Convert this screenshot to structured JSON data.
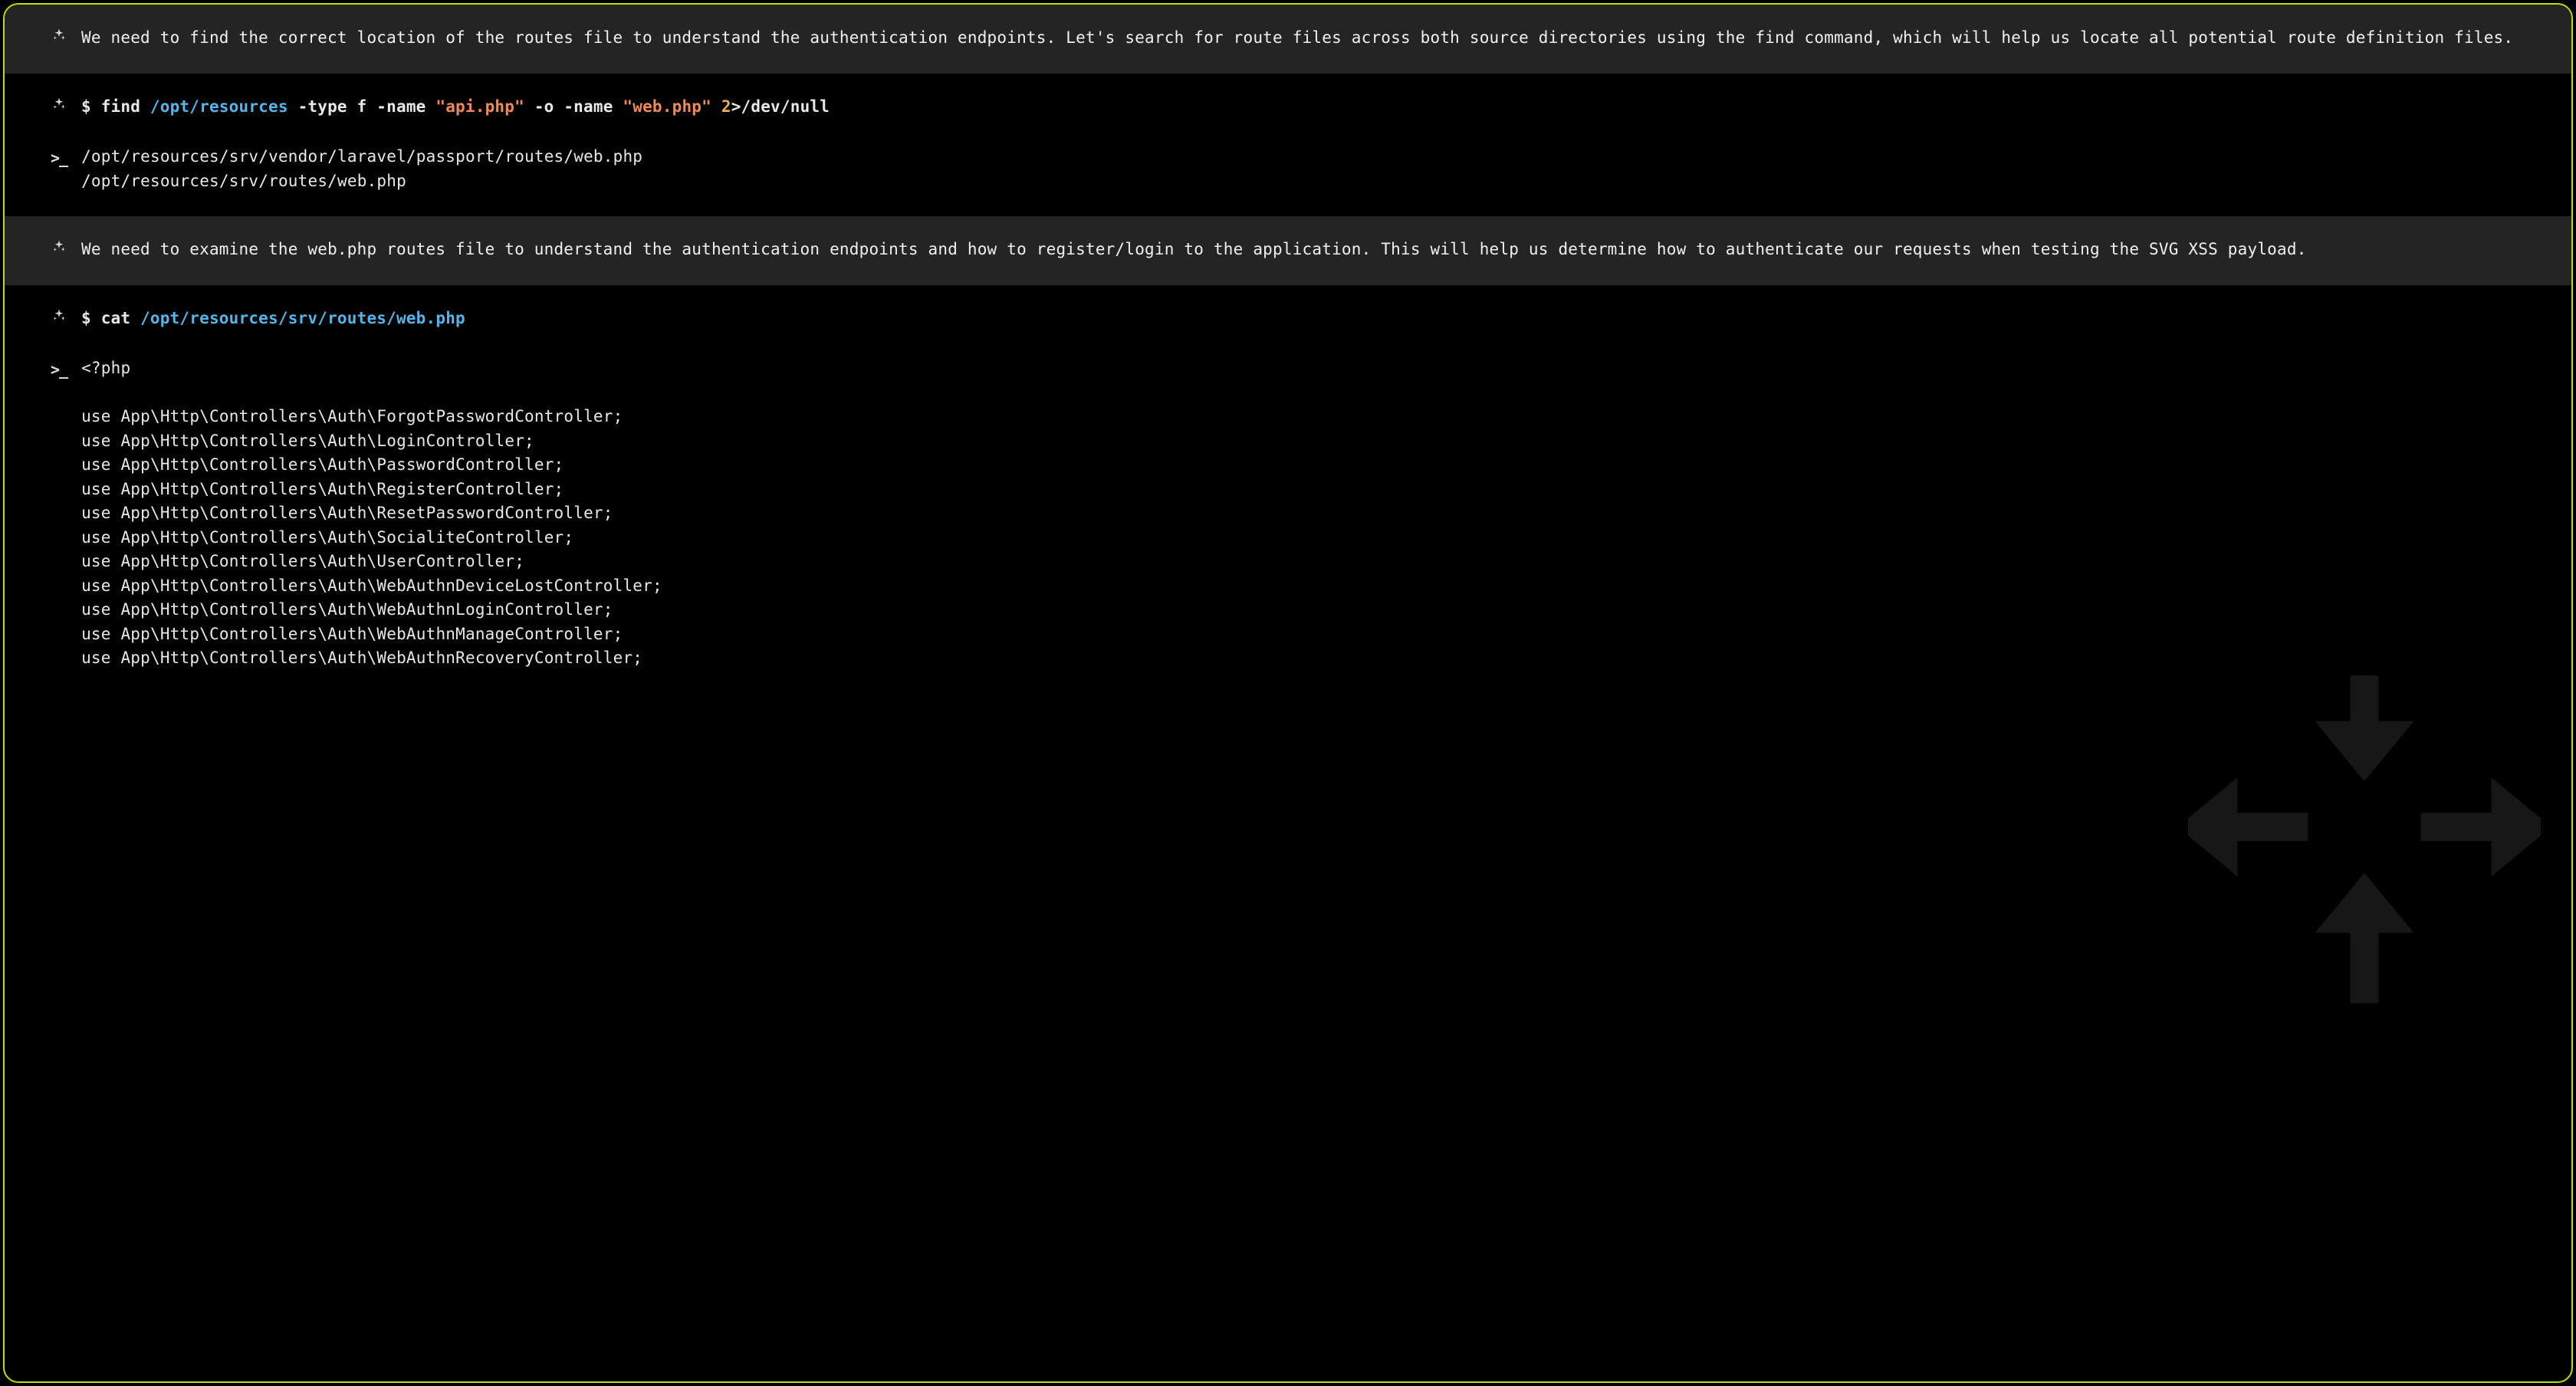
{
  "blocks": {
    "note1": "We need to find the correct location of the routes file to understand the authentication endpoints. Let's search for route files across both source directories using the find command, which will help us locate all potential route definition files.",
    "cmd1": {
      "prompt": "$",
      "base": "find",
      "path": "/opt/resources",
      "flags1": "-type f -name",
      "str1": "\"api.php\"",
      "flags2": "-o -name",
      "str2": "\"web.php\"",
      "num": "2",
      "tail": ">/dev/null"
    },
    "out1": "/opt/resources/srv/vendor/laravel/passport/routes/web.php\n/opt/resources/srv/routes/web.php",
    "note2": "We need to examine the web.php routes file to understand the authentication endpoints and how to register/login to the application. This will help us determine how to authenticate our requests when testing the SVG XSS payload.",
    "cmd2": {
      "prompt": "$",
      "base": "cat",
      "path": "/opt/resources/srv/routes/web.php"
    },
    "out2": "<?php\n\nuse App\\Http\\Controllers\\Auth\\ForgotPasswordController;\nuse App\\Http\\Controllers\\Auth\\LoginController;\nuse App\\Http\\Controllers\\Auth\\PasswordController;\nuse App\\Http\\Controllers\\Auth\\RegisterController;\nuse App\\Http\\Controllers\\Auth\\ResetPasswordController;\nuse App\\Http\\Controllers\\Auth\\SocialiteController;\nuse App\\Http\\Controllers\\Auth\\UserController;\nuse App\\Http\\Controllers\\Auth\\WebAuthnDeviceLostController;\nuse App\\Http\\Controllers\\Auth\\WebAuthnLoginController;\nuse App\\Http\\Controllers\\Auth\\WebAuthnManageController;\nuse App\\Http\\Controllers\\Auth\\WebAuthnRecoveryController;"
  },
  "icons": {
    "sparkle": "sparkle-icon",
    "output": ">_"
  }
}
